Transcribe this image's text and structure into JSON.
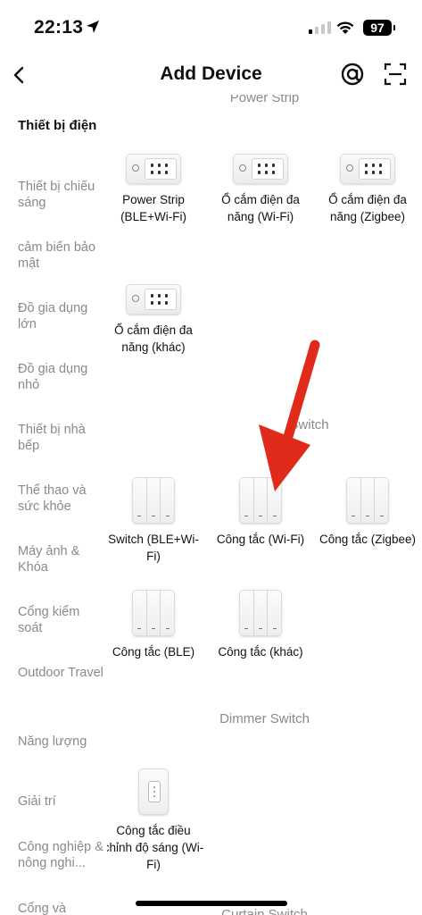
{
  "status_bar": {
    "time": "22:13",
    "battery": "97"
  },
  "header": {
    "title": "Add Device"
  },
  "sidebar": {
    "items": [
      {
        "label": "Thiết bị điện",
        "active": true
      },
      {
        "label": "Thiết bị chiếu sáng"
      },
      {
        "label": "cảm biến bảo mật"
      },
      {
        "label": "Đồ gia dụng lớn"
      },
      {
        "label": "Đồ gia dụng nhỏ"
      },
      {
        "label": "Thiết bị nhà bếp"
      },
      {
        "label": "Thể thao và sức khỏe"
      },
      {
        "label": "Máy ảnh & Khóa"
      },
      {
        "label": "Cổng kiểm soát"
      },
      {
        "label": "Outdoor Travel"
      },
      {
        "label": "Năng lượng"
      },
      {
        "label": "Giải trí"
      },
      {
        "label": "Công nghiệp & nông nghi..."
      },
      {
        "label": "Cổng và"
      }
    ]
  },
  "sections": {
    "power_strip": {
      "title": "Power Strip",
      "devices": [
        {
          "label": "Power Strip (BLE+Wi-Fi)"
        },
        {
          "label": "Ổ cắm điện đa năng (Wi-Fi)"
        },
        {
          "label": "Ổ cắm điện đa năng (Zigbee)"
        },
        {
          "label": "Ổ cắm điện đa năng (khác)"
        }
      ]
    },
    "switch": {
      "title": "Switch",
      "devices": [
        {
          "label": "Switch (BLE+Wi-Fi)"
        },
        {
          "label": "Công tắc (Wi-Fi)"
        },
        {
          "label": "Công tắc (Zigbee)"
        },
        {
          "label": "Công tắc (BLE)"
        },
        {
          "label": "Công tắc (khác)"
        }
      ]
    },
    "dimmer": {
      "title": "Dimmer Switch",
      "devices": [
        {
          "label": "Công tắc điều chỉnh độ sáng (Wi-Fi)"
        }
      ]
    },
    "curtain": {
      "title": "Curtain Switch"
    }
  },
  "colors": {
    "annotation_arrow": "#e02a1a",
    "muted_text": "#8a8a8e"
  }
}
